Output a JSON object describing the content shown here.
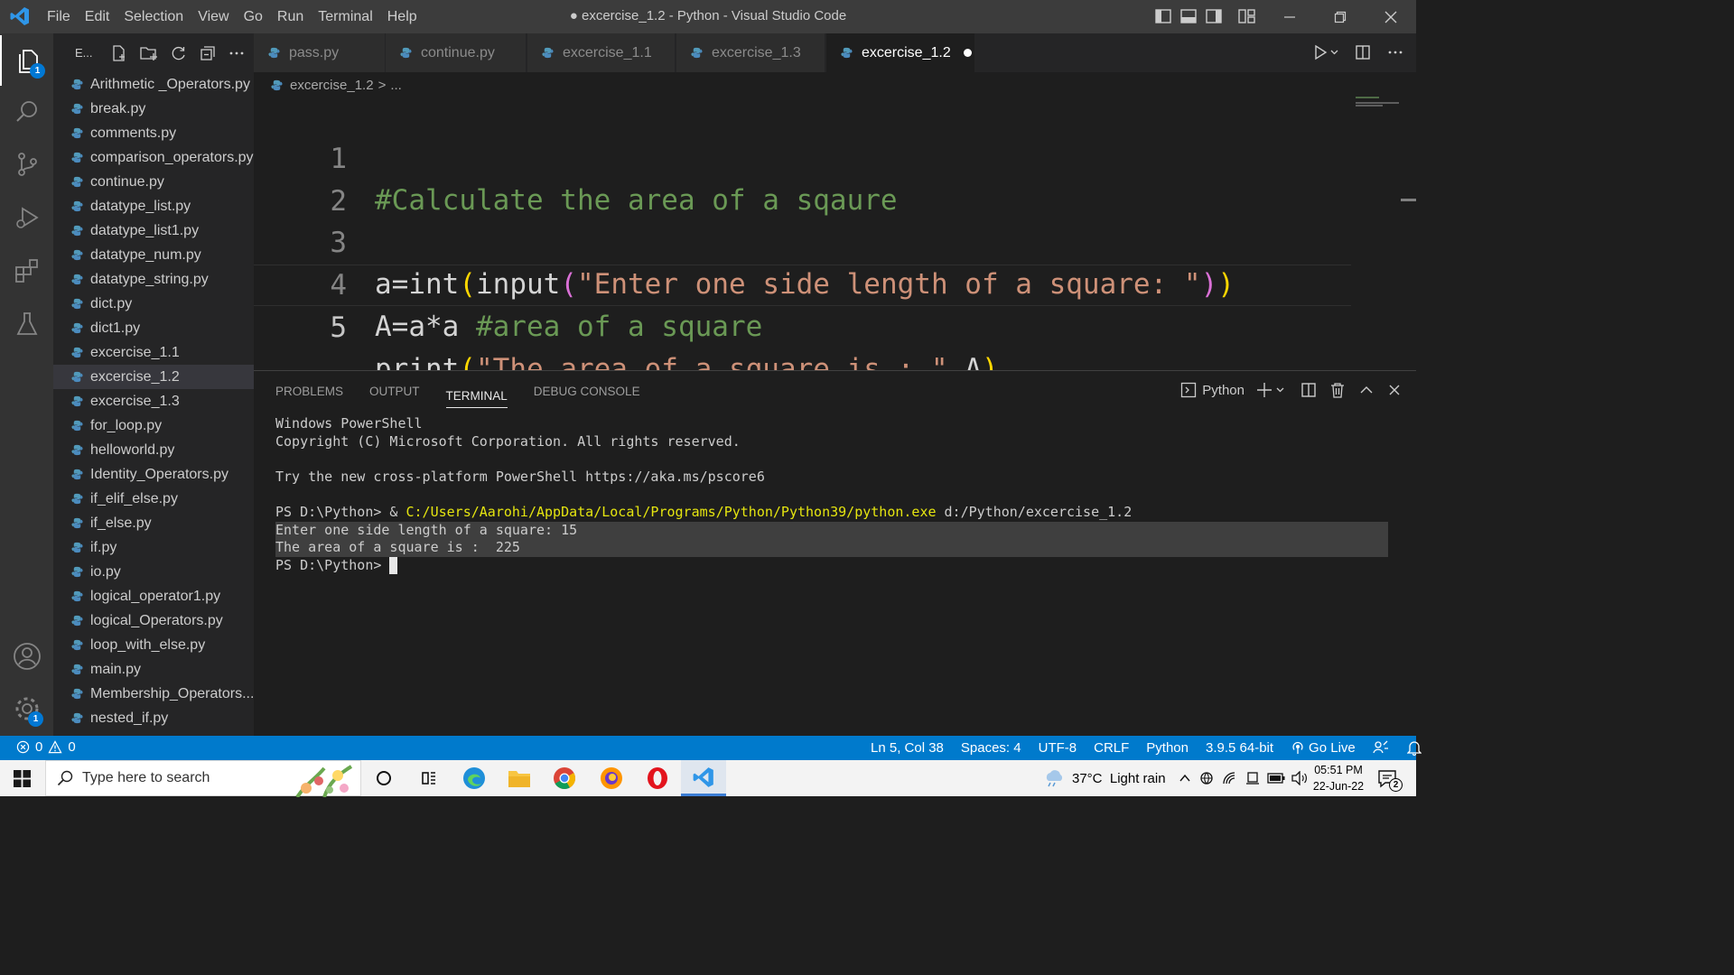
{
  "window": {
    "title": "● excercise_1.2 - Python - Visual Studio Code",
    "menu": [
      "File",
      "Edit",
      "Selection",
      "View",
      "Go",
      "Run",
      "Terminal",
      "Help"
    ]
  },
  "activity": {
    "explorer_badge": "1",
    "settings_badge": "1"
  },
  "sidebar": {
    "title": "E...",
    "files": [
      "Arithmetic _Operators.py",
      "break.py",
      "comments.py",
      "comparison_operators.py",
      "continue.py",
      "datatype_list.py",
      "datatype_list1.py",
      "datatype_num.py",
      "datatype_string.py",
      "dict.py",
      "dict1.py",
      "excercise_1.1",
      "excercise_1.2",
      "excercise_1.3",
      "for_loop.py",
      "helloworld.py",
      "Identity_Operators.py",
      "if_elif_else.py",
      "if_else.py",
      "if.py",
      "io.py",
      "logical_operator1.py",
      "logical_Operators.py",
      "loop_with_else.py",
      "main.py",
      "Membership_Operators...",
      "nested_if.py"
    ],
    "selected_index": 12
  },
  "tabs": [
    "pass.py",
    "continue.py",
    "excercise_1.1",
    "excercise_1.3",
    "excercise_1.2"
  ],
  "breadcrumb": {
    "file": "excercise_1.2",
    "sep": ">",
    "more": "..."
  },
  "editor": {
    "line_numbers": [
      "1",
      "2",
      "3",
      "4",
      "5"
    ],
    "line1": "#Calculate the area of a sqaure",
    "line3": {
      "var": "a",
      "eq": "=",
      "fn1": "int",
      "p1": "(",
      "fn2": "input",
      "p2": "(",
      "str": "\"Enter one side length of a square: \"",
      "p2c": ")",
      "p1c": ")"
    },
    "line4": {
      "code": "A=a*a ",
      "comment": "#area of a square"
    },
    "line5": {
      "fn": "print",
      "p": "(",
      "str": "\"The area of a square is : \"",
      "rest": ",A",
      "pc": ")"
    }
  },
  "panel": {
    "tabs": [
      "PROBLEMS",
      "OUTPUT",
      "TERMINAL",
      "DEBUG CONSOLE"
    ],
    "active_tab": "TERMINAL",
    "terminal_name": "Python",
    "lines": {
      "l1": "Windows PowerShell",
      "l2": "Copyright (C) Microsoft Corporation. All rights reserved.",
      "l3": "",
      "l4": "Try the new cross-platform PowerShell https://aka.ms/pscore6",
      "l5": "",
      "l6_prompt": "PS D:\\Python> & ",
      "l6_exe": "C:/Users/Aarohi/AppData/Local/Programs/Python/Python39/python.exe",
      "l6_arg": " d:/Python/excercise_1.2",
      "l7": "Enter one side length of a square: 15",
      "l8": "The area of a square is :  225",
      "l9": "PS D:\\Python> "
    }
  },
  "status": {
    "errors": "0",
    "warnings": "0",
    "position": "Ln 5, Col 38",
    "spaces": "Spaces: 4",
    "encoding": "UTF-8",
    "eol": "CRLF",
    "language": "Python",
    "interpreter": "3.9.5 64-bit",
    "golive": "Go Live"
  },
  "taskbar": {
    "search_placeholder": "Type here to search",
    "weather": "37°C  Light rain",
    "time": "05:51 PM",
    "date": "22-Jun-22",
    "notifications": "2"
  },
  "colors": {
    "accent": "#007acc",
    "comment": "#6a9955",
    "string": "#ce9178",
    "function": "#dcdcaa",
    "bracket1": "#ffd700",
    "bracket2": "#da70d6"
  }
}
